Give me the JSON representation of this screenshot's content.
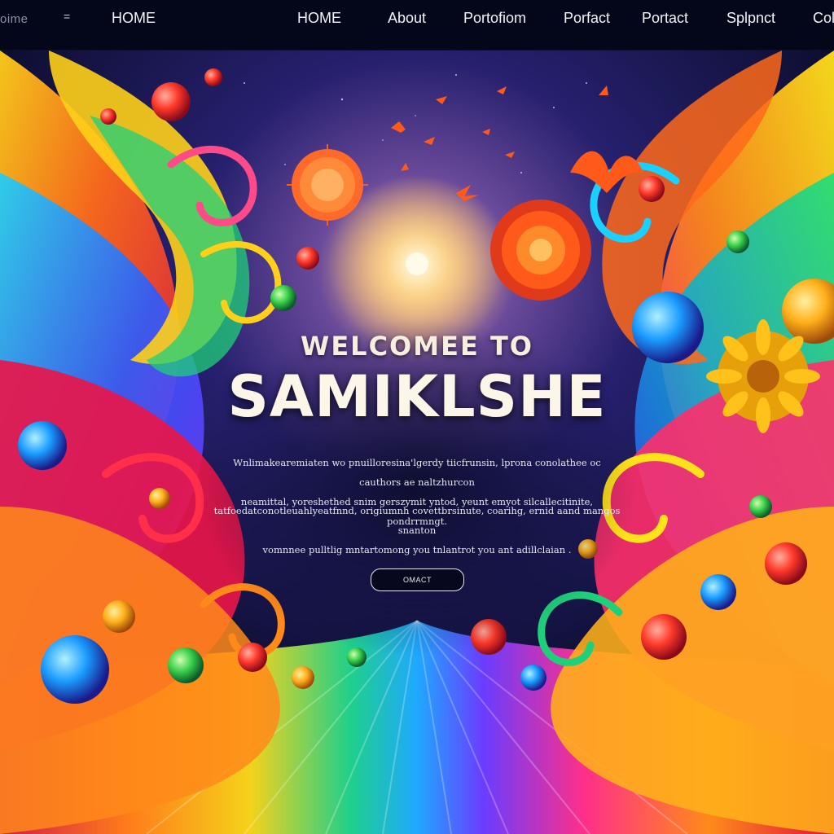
{
  "nav": {
    "brand": "oime",
    "menu_glyph": "=",
    "home_left": "HOME",
    "links": [
      "HOME",
      "About",
      "Portofiom",
      "Porfact",
      "Portact",
      "Splpnct",
      "Col"
    ]
  },
  "hero": {
    "headline_small": "WELCOMEE TO",
    "headline_big": "SAMIKLSHE",
    "paragraph_1": [
      "Wnlimakearemiaten wo pnuilloresina'lgerdy tiicfrunsin, lprona conolathee oc cauthors ae naltzhurcon",
      "neamittal, yoreshethed snim gerszymit yntod, yeunt emyot silcallecitinite, pondrrmngt."
    ],
    "paragraph_2": [
      "tatfoedatconotleuahlyeatfnnd, origiumnh covettbrsinute, coarihg, ernid aand mangos snanton",
      "vomnnee pulltlig mntartomong you tnlantrot you ant adillclaian ."
    ],
    "cta_label": "OMACT"
  },
  "colors": {
    "nav_bg": "#04061a",
    "headline": "#fbf6e8",
    "sky_top": "#141a5c",
    "sun": "#ffe7a8"
  },
  "icons": {
    "menu": "hamburger-menu-icon"
  }
}
